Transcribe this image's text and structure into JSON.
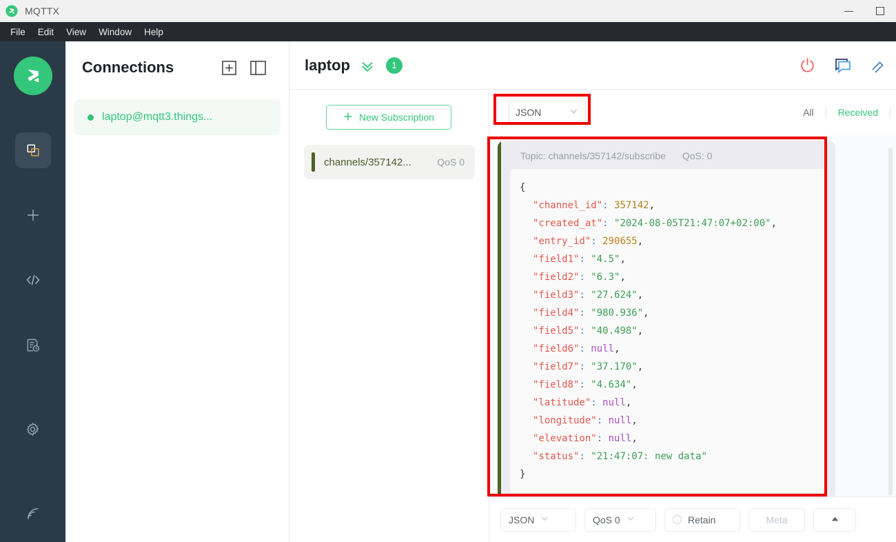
{
  "window": {
    "app_title": "MQTTX",
    "logo_icon": "mqttx-logo-icon",
    "minimize_label": "–",
    "maximize_label": "□"
  },
  "menubar": {
    "items": [
      {
        "label": "File"
      },
      {
        "label": "Edit"
      },
      {
        "label": "View"
      },
      {
        "label": "Window"
      },
      {
        "label": "Help"
      }
    ]
  },
  "rail": {
    "logo_icon": "mqttx-logo-icon",
    "items": [
      {
        "icon": "connections-icon",
        "active": true
      },
      {
        "icon": "plus-icon",
        "active": false
      },
      {
        "icon": "code-icon",
        "active": false
      },
      {
        "icon": "log-clock-icon",
        "active": false
      },
      {
        "icon": "gear-icon",
        "active": false
      },
      {
        "icon": "broadcast-icon",
        "active": false
      }
    ]
  },
  "connections": {
    "title": "Connections",
    "new_icon": "plus-square-icon",
    "layout_icon": "panel-toggle-icon",
    "items": [
      {
        "name": "laptop@mqtt3.things...",
        "status_color": "#34c77b"
      }
    ]
  },
  "main": {
    "title": "laptop",
    "chevron_icon": "chevron-double-down-icon",
    "badge_count": "1",
    "header_icons": [
      {
        "icon": "power-icon",
        "color": "#f06a6a"
      },
      {
        "icon": "chat-bubble-icon",
        "color": "#4a7ebb"
      },
      {
        "icon": "edit-icon",
        "color": "#4a7ebb"
      }
    ]
  },
  "subscriptions": {
    "new_subscription_label": "New Subscription",
    "new_subscription_icon": "plus-icon",
    "items": [
      {
        "topic": "channels/357142...",
        "qos": "QoS 0",
        "color": "#4c6322"
      }
    ]
  },
  "messages": {
    "format_selected": "JSON",
    "format_chevron_icon": "chevron-down-icon",
    "filters": [
      {
        "label": "All",
        "active": false
      },
      {
        "label": "Received",
        "active": true
      }
    ],
    "items": [
      {
        "topic_label": "Topic: channels/357142/subscribe",
        "qos_label": "QoS: 0",
        "lines": [
          {
            "indent": 0,
            "tokens": [
              {
                "t": "{",
                "c": "p"
              }
            ]
          },
          {
            "indent": 1,
            "tokens": [
              {
                "t": "\"channel_id\"",
                "c": "k"
              },
              {
                "t": ":",
                "c": "c"
              },
              {
                "t": " 357142",
                "c": "n"
              },
              {
                "t": ",",
                "c": "p"
              }
            ]
          },
          {
            "indent": 1,
            "tokens": [
              {
                "t": "\"created_at\"",
                "c": "k"
              },
              {
                "t": ":",
                "c": "c"
              },
              {
                "t": " \"2024-08-05T21:47:07+02:00\"",
                "c": "s"
              },
              {
                "t": ",",
                "c": "p"
              }
            ]
          },
          {
            "indent": 1,
            "tokens": [
              {
                "t": "\"entry_id\"",
                "c": "k"
              },
              {
                "t": ":",
                "c": "c"
              },
              {
                "t": " 290655",
                "c": "n"
              },
              {
                "t": ",",
                "c": "p"
              }
            ]
          },
          {
            "indent": 1,
            "tokens": [
              {
                "t": "\"field1\"",
                "c": "k"
              },
              {
                "t": ":",
                "c": "c"
              },
              {
                "t": " \"4.5\"",
                "c": "s"
              },
              {
                "t": ",",
                "c": "p"
              }
            ]
          },
          {
            "indent": 1,
            "tokens": [
              {
                "t": "\"field2\"",
                "c": "k"
              },
              {
                "t": ":",
                "c": "c"
              },
              {
                "t": " \"6.3\"",
                "c": "s"
              },
              {
                "t": ",",
                "c": "p"
              }
            ]
          },
          {
            "indent": 1,
            "tokens": [
              {
                "t": "\"field3\"",
                "c": "k"
              },
              {
                "t": ":",
                "c": "c"
              },
              {
                "t": " \"27.624\"",
                "c": "s"
              },
              {
                "t": ",",
                "c": "p"
              }
            ]
          },
          {
            "indent": 1,
            "tokens": [
              {
                "t": "\"field4\"",
                "c": "k"
              },
              {
                "t": ":",
                "c": "c"
              },
              {
                "t": " \"980.936\"",
                "c": "s"
              },
              {
                "t": ",",
                "c": "p"
              }
            ]
          },
          {
            "indent": 1,
            "tokens": [
              {
                "t": "\"field5\"",
                "c": "k"
              },
              {
                "t": ":",
                "c": "c"
              },
              {
                "t": " \"40.498\"",
                "c": "s"
              },
              {
                "t": ",",
                "c": "p"
              }
            ]
          },
          {
            "indent": 1,
            "tokens": [
              {
                "t": "\"field6\"",
                "c": "k"
              },
              {
                "t": ":",
                "c": "c"
              },
              {
                "t": " null",
                "c": "nl"
              },
              {
                "t": ",",
                "c": "p"
              }
            ]
          },
          {
            "indent": 1,
            "tokens": [
              {
                "t": "\"field7\"",
                "c": "k"
              },
              {
                "t": ":",
                "c": "c"
              },
              {
                "t": " \"37.170\"",
                "c": "s"
              },
              {
                "t": ",",
                "c": "p"
              }
            ]
          },
          {
            "indent": 1,
            "tokens": [
              {
                "t": "\"field8\"",
                "c": "k"
              },
              {
                "t": ":",
                "c": "c"
              },
              {
                "t": " \"4.634\"",
                "c": "s"
              },
              {
                "t": ",",
                "c": "p"
              }
            ]
          },
          {
            "indent": 1,
            "tokens": [
              {
                "t": "\"latitude\"",
                "c": "k"
              },
              {
                "t": ":",
                "c": "c"
              },
              {
                "t": " null",
                "c": "nl"
              },
              {
                "t": ",",
                "c": "p"
              }
            ]
          },
          {
            "indent": 1,
            "tokens": [
              {
                "t": "\"longitude\"",
                "c": "k"
              },
              {
                "t": ":",
                "c": "c"
              },
              {
                "t": " null",
                "c": "nl"
              },
              {
                "t": ",",
                "c": "p"
              }
            ]
          },
          {
            "indent": 1,
            "tokens": [
              {
                "t": "\"elevation\"",
                "c": "k"
              },
              {
                "t": ":",
                "c": "c"
              },
              {
                "t": " null",
                "c": "nl"
              },
              {
                "t": ",",
                "c": "p"
              }
            ]
          },
          {
            "indent": 1,
            "tokens": [
              {
                "t": "\"status\"",
                "c": "k"
              },
              {
                "t": ":",
                "c": "c"
              },
              {
                "t": " \"21:47:07: new data\"",
                "c": "s"
              }
            ]
          },
          {
            "indent": 0,
            "tokens": [
              {
                "t": "}",
                "c": "p"
              }
            ]
          }
        ]
      }
    ]
  },
  "publish_bar": {
    "format": "JSON",
    "qos": "QoS 0",
    "retain_label": "Retain",
    "meta_label": "Meta",
    "collapse_icon": "chevron-up-icon"
  },
  "annotations": {
    "color": "#ee0000",
    "boxes": [
      {
        "target": "message-format-select"
      },
      {
        "target": "message-list"
      }
    ]
  }
}
